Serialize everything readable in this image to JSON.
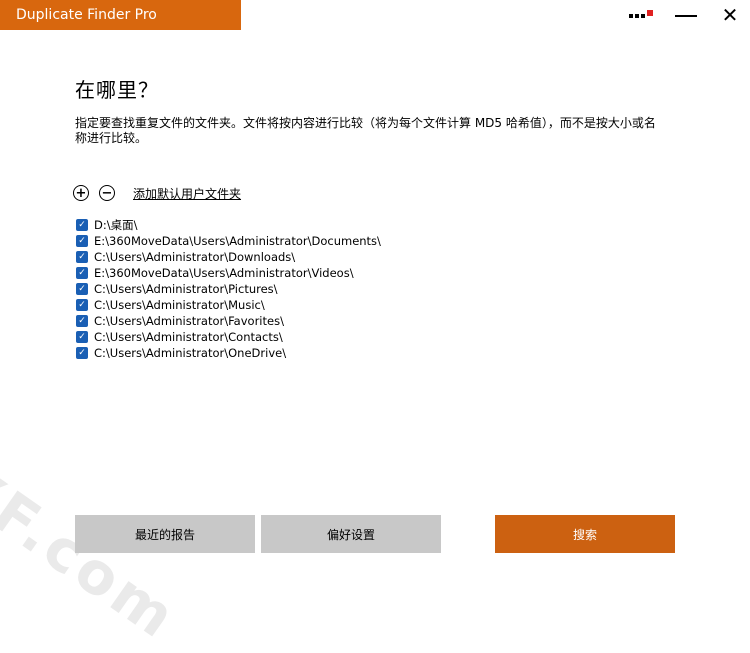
{
  "app": {
    "title": "Duplicate Finder Pro"
  },
  "window": {
    "minimize": "—",
    "close": "✕"
  },
  "main": {
    "heading": "在哪里？",
    "description": "指定要查找重复文件的文件夹。文件将按内容进行比较（将为每个文件计算 MD5 哈希值），而不是按大小或名称进行比较。",
    "add_symbol": "+",
    "remove_symbol": "−",
    "add_default_label": "添加默认用户文件夹",
    "folders": [
      {
        "path": "D:\\桌面\\",
        "checked": true
      },
      {
        "path": "E:\\360MoveData\\Users\\Administrator\\Documents\\",
        "checked": true
      },
      {
        "path": "C:\\Users\\Administrator\\Downloads\\",
        "checked": true
      },
      {
        "path": "E:\\360MoveData\\Users\\Administrator\\Videos\\",
        "checked": true
      },
      {
        "path": "C:\\Users\\Administrator\\Pictures\\",
        "checked": true
      },
      {
        "path": "C:\\Users\\Administrator\\Music\\",
        "checked": true
      },
      {
        "path": "C:\\Users\\Administrator\\Favorites\\",
        "checked": true
      },
      {
        "path": "C:\\Users\\Administrator\\Contacts\\",
        "checked": true
      },
      {
        "path": "C:\\Users\\Administrator\\OneDrive\\",
        "checked": true
      }
    ]
  },
  "footer": {
    "recent_reports_label": "最近的报告",
    "preferences_label": "偏好设置",
    "search_label": "搜索"
  },
  "watermark": "XF.com",
  "colors": {
    "accent": "#d8670e",
    "search_button": "#cc6111",
    "checkbox": "#1a5fb4",
    "secondary_button": "#c8c8c8"
  }
}
